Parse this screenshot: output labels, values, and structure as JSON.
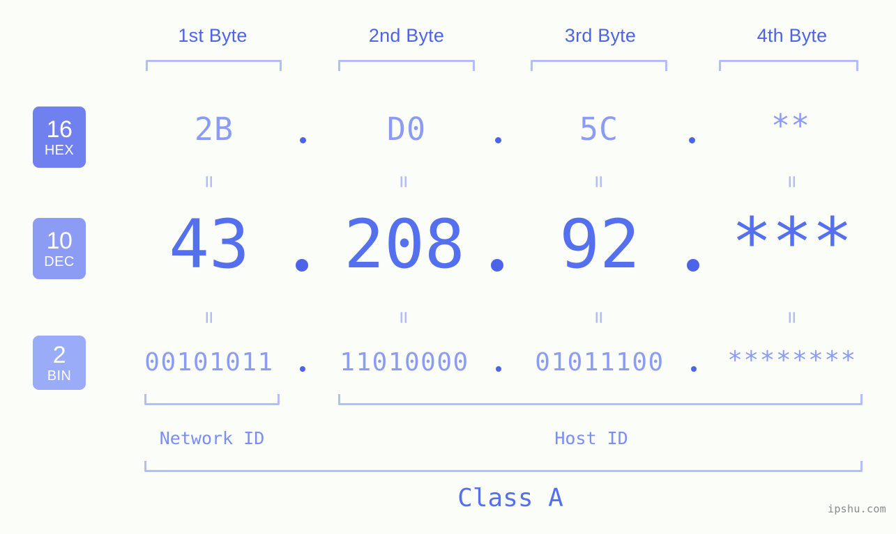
{
  "page": {
    "background_color": "#fbfdf8",
    "accent_color": "#5570ef",
    "light_accent_color": "#8c9bf4",
    "bracket_color": "#b3bdf7",
    "watermark": "ipshu.com"
  },
  "byte_headers": [
    {
      "label": "1st Byte"
    },
    {
      "label": "2nd Byte"
    },
    {
      "label": "3rd Byte"
    },
    {
      "label": "4th Byte"
    }
  ],
  "bases": [
    {
      "number": "16",
      "system": "HEX",
      "color": "#7081ef"
    },
    {
      "number": "10",
      "system": "DEC",
      "color": "#8c9bf4"
    },
    {
      "number": "2",
      "system": "BIN",
      "color": "#9aabf8"
    }
  ],
  "rows": {
    "hex": {
      "base_number": "16",
      "base_system": "HEX",
      "values": [
        "2B",
        "D0",
        "5C",
        "**"
      ],
      "separators": [
        ".",
        ".",
        "."
      ]
    },
    "dec": {
      "base_number": "10",
      "base_system": "DEC",
      "values": [
        "43",
        "208",
        "92",
        "***"
      ],
      "separators": [
        ".",
        ".",
        "."
      ]
    },
    "bin": {
      "base_number": "2",
      "base_system": "BIN",
      "values": [
        "00101011",
        "11010000",
        "01011100",
        "********"
      ],
      "separators": [
        ".",
        ".",
        "."
      ]
    }
  },
  "equal_marks": {
    "glyph": "=",
    "hex_to_dec_count": 4,
    "dec_to_bin_count": 4
  },
  "id_sections": [
    {
      "label": "Network ID"
    },
    {
      "label": "Host ID"
    }
  ],
  "class_section": {
    "label": "Class A"
  }
}
